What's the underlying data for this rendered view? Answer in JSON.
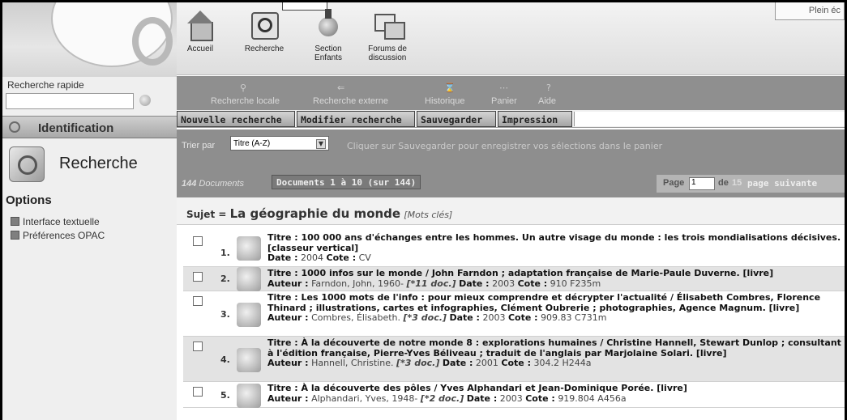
{
  "sidebar": {
    "quick_search_label": "Recherche rapide",
    "identification_label": "Identification",
    "search_label": "Recherche",
    "options_title": "Options",
    "options": [
      {
        "label": "Interface textuelle"
      },
      {
        "label": "Préférences OPAC"
      }
    ]
  },
  "toolbar": {
    "fullscreen": "Plein éc",
    "items": [
      {
        "label": "Accueil",
        "icon": "home-icon"
      },
      {
        "label": "Recherche",
        "icon": "search-icon"
      },
      {
        "label": "Section Enfants",
        "icon": "kids-section-icon"
      },
      {
        "label": "Forums de discussion",
        "icon": "forum-icon"
      }
    ]
  },
  "subnav": {
    "items": [
      {
        "label": "Recherche locale"
      },
      {
        "label": "Recherche externe"
      },
      {
        "label": "Historique"
      },
      {
        "label": "Panier"
      },
      {
        "label": "Aide"
      }
    ]
  },
  "actions": {
    "new_search": "Nouvelle recherche",
    "modify_search": "Modifier recherche",
    "save": "Sauvegarder",
    "print": "Impression"
  },
  "sort": {
    "label": "Trier par",
    "selected": "Titre (A-Z)",
    "hint": "Cliquer sur Sauvegarder pour enregistrer vos sélections dans le panier"
  },
  "paging": {
    "doc_count": "144",
    "doc_count_suffix": "Documents",
    "range": "Documents 1 à 10 (sur 144)",
    "page_label": "Page",
    "page_value": "1",
    "page_of": "de",
    "page_total": "15",
    "next": "page suivante"
  },
  "subject": {
    "prefix": "Sujet =",
    "value": "La géographie du monde",
    "keywords": "[Mots clés]"
  },
  "results": [
    {
      "num": "1.",
      "title_label": "Titre :",
      "title": "100 000 ans d'échanges entre les hommes. Un autre visage du monde : les trois mondialisations décisives. [classeur vertical]",
      "author_label": "",
      "author": "",
      "docs": "",
      "date_label": "Date :",
      "date": "2004",
      "cote_label": "Cote :",
      "cote": "CV"
    },
    {
      "num": "2.",
      "title_label": "Titre :",
      "title": "1000 infos sur le monde / John Farndon ; adaptation française de Marie-Paule Duverne. [livre]",
      "author_label": "Auteur :",
      "author": "Farndon, John, 1960-",
      "docs": "[*11 doc.]",
      "date_label": "Date :",
      "date": "2003",
      "cote_label": "Cote :",
      "cote": "910 F235m"
    },
    {
      "num": "3.",
      "title_label": "Titre :",
      "title": "Les 1000 mots de l'info : pour mieux comprendre et décrypter l'actualité / Élisabeth Combres, Florence Thinard ; illustrations, cartes et infographies, Clément Oubrerie ; photographies, Agence Magnum. [livre]",
      "author_label": "Auteur :",
      "author": "Combres, Élisabeth.",
      "docs": "[*3 doc.]",
      "date_label": "Date :",
      "date": "2003",
      "cote_label": "Cote :",
      "cote": "909.83 C731m"
    },
    {
      "num": "4.",
      "title_label": "Titre :",
      "title": "À la découverte de notre monde 8 : explorations humaines / Christine Hannell, Stewart Dunlop ; consultant à l'édition française, Pierre-Yves Béliveau ; traduit de l'anglais par Marjolaine Solari. [livre]",
      "author_label": "Auteur :",
      "author": "Hannell, Christine.",
      "docs": "[*3 doc.]",
      "date_label": "Date :",
      "date": "2001",
      "cote_label": "Cote :",
      "cote": "304.2 H244a"
    },
    {
      "num": "5.",
      "title_label": "Titre :",
      "title": "À la découverte des pôles / Yves Alphandari et Jean-Dominique Porée. [livre]",
      "author_label": "Auteur :",
      "author": "Alphandari, Yves, 1948-",
      "docs": "[*2 doc.]",
      "date_label": "Date :",
      "date": "2003",
      "cote_label": "Cote :",
      "cote": "919.804 A456a"
    }
  ]
}
